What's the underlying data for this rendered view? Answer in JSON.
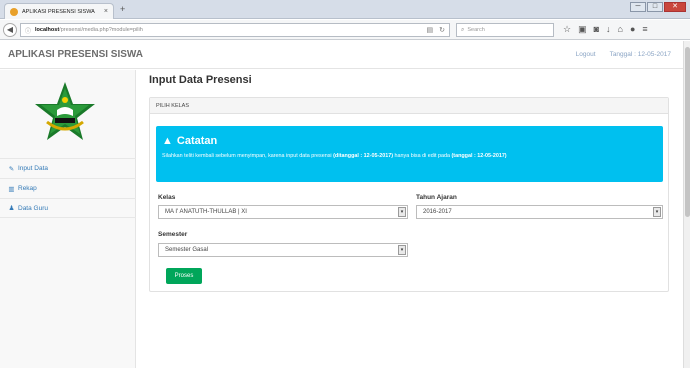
{
  "browser": {
    "tab_title": "APLIKASI PRESENSI SISWA",
    "tab_close": "×",
    "new_tab": "+",
    "url_host": "localhost",
    "url_path": "/presensi/media.php?module=pilih",
    "search_placeholder": "Search",
    "win_min": "─",
    "win_max": "□",
    "win_close": "✕"
  },
  "app": {
    "title": "APLIKASI PRESENSI SISWA",
    "logout": "Logout",
    "date": "Tanggal : 12-05-2017"
  },
  "sidebar": {
    "items": [
      {
        "label": "Input Data",
        "icon": "edit-icon",
        "glyph": "✎"
      },
      {
        "label": "Rekap",
        "icon": "bar-chart-icon",
        "glyph": "▥"
      },
      {
        "label": "Data Guru",
        "icon": "user-icon",
        "glyph": "♟"
      }
    ]
  },
  "main": {
    "page_title": "Input Data Presensi",
    "panel_heading": "PILIH KELAS",
    "alert": {
      "title": "Catatan",
      "text_before": "Silahkan teliti kembali sebelum menyimpan, karena input data presensi ",
      "bold_1": "(ditanggal : 12-05-2017)",
      "text_middle": " hanya bisa di edit pada ",
      "bold_2": "(tanggal : 12-05-2017)"
    },
    "kelas_label": "Kelas",
    "kelas_value": "MA I' ANATUTH-THULLAB | XI",
    "tahun_label": "Tahun Ajaran",
    "tahun_value": "2016-2017",
    "semester_label": "Semester",
    "semester_value": "Semester Gasal",
    "proses_label": "Proses"
  },
  "colors": {
    "alert": "#00c0ef",
    "button": "#00a65a",
    "link": "#337ab7"
  }
}
